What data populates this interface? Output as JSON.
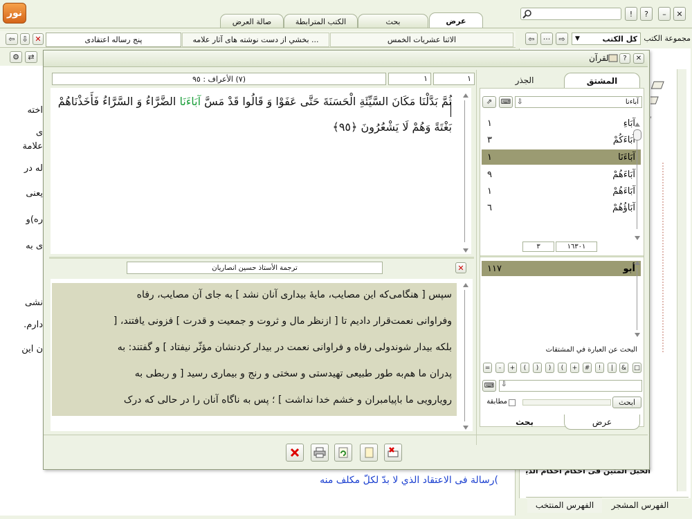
{
  "app": {
    "logo_text": "نور",
    "top_tabs": [
      "عرض",
      "بحث",
      "الكتب المترابطة",
      "صالة العرض"
    ],
    "search_placeholder": "",
    "win_buttons": [
      "!",
      "?",
      "–",
      "✕"
    ]
  },
  "book_tabs": {
    "items": [
      "الاثنا عشريات الخمس",
      "بخشي از دست نوشته هاى آثار علامه ...",
      "پنج رساله اعتقادى"
    ]
  },
  "collection": {
    "label": "مجموعة الكتب",
    "value": "كل الكتب"
  },
  "background_doc": {
    "lines": [
      "اخته",
      "ی",
      "علامة",
      "له در",
      "یعنی",
      "ره)و",
      "ی به",
      "نشی",
      "دارم.",
      "ن این"
    ],
    "footer_text": ")رسالة فی الاعتقاد الذي لا بدّ لكلّ مكلف منه"
  },
  "right_tree": {
    "visible_item": "الحبل المتين فى احكام احكام الدين",
    "tabs": [
      "الفهرس المشجر",
      "الفهرس المنتخب"
    ]
  },
  "modal": {
    "title": "القرآن",
    "verse_header": {
      "surah": "(٧) الأعراف : ٩٥",
      "field1": "١",
      "field2": "١"
    },
    "verse_text_part1": "ثُمَّ بَدَّلْنَا مَكَانَ السَّيِّئَةِ الْحَسَنَةَ حَتَّى عَفَوْا وَ قَالُوا قَدْ مَسَّ ",
    "verse_highlight": "آبَاءَنَا",
    "verse_text_part2": " الضَّرَّاءُ وَ السَّرَّاءُ فَأَخَذْنَاهُمْ",
    "verse_line2": "بَغْتَةً وَهُمْ لَا يَشْعُرُونَ ﴿٩٥﴾",
    "translation_title": "ترجمة الأستاذ حسين انصاريان",
    "translation_lines": [
      "سپس [ هنگامی‌که این مصایب، مایهٔ بیداری آنان نشد ] به جای آن مصایب، رفاه",
      "وفراوانی نعمت‌قرار دادیم تا [ از‌نظر مال و ثروت و جمعیت و قدرت ] فزونی یافتند، [",
      "بلکه بیدار شوند‌ولی رفاه و فراوانی نعمت در بیدار کردنشان مؤثّر نیفتاد ] و گفتند: به",
      "پدران ما هم‌به طور طبیعی تهیدستی و سختی و رنج و بیماری رسید [ و ربطی به",
      "رویارویی ما با‌پیامبران و خشم خدا نداشت ] ؛ پس به ناگاه آنان را در حالی که درک"
    ],
    "side_tabs": [
      "المشتق",
      "الجذر"
    ],
    "search_value": "آباءنا",
    "words": [
      {
        "word": "آبَاءِ",
        "count": "١"
      },
      {
        "word": "آبَاءَكُمْ",
        "count": "٣"
      },
      {
        "word": "آبَاءَنَا",
        "count": "١"
      },
      {
        "word": "آبَاءَهُمْ",
        "count": "٩"
      },
      {
        "word": "آبَاءَهُمْ",
        "count": "١"
      },
      {
        "word": "آبَاؤُهُمْ",
        "count": "٦"
      }
    ],
    "pager": {
      "total": "١٦٣٠١",
      "current": "٣"
    },
    "root": {
      "word": "أبو",
      "count": "١١٧"
    },
    "phrase_label": "البحث عن العبارة في المشتقات",
    "operators": [
      "□",
      "&",
      "|",
      "!",
      "#",
      "+",
      "(",
      ")",
      ")",
      "(",
      "+",
      "-",
      "="
    ],
    "search_button": "ابحث",
    "match_label": "مطابقة",
    "bottom_tabs": [
      "عرض",
      "بحث"
    ]
  }
}
